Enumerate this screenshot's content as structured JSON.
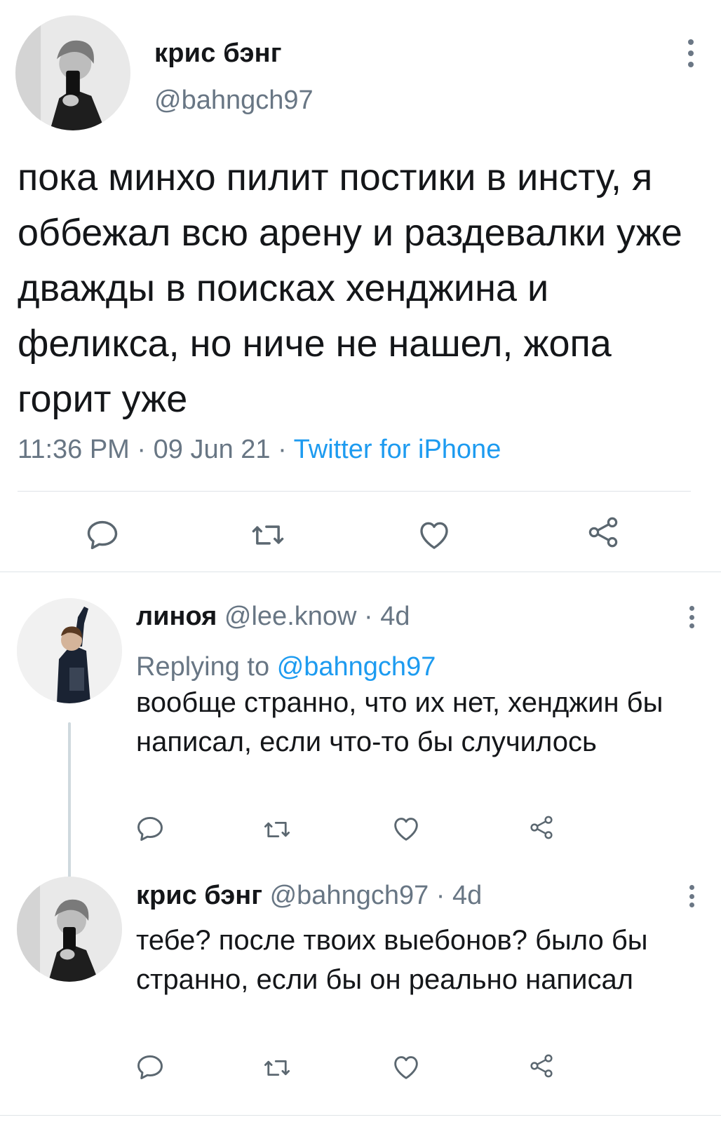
{
  "main_tweet": {
    "author_name": "крис бэнг",
    "author_handle": "@bahngch97",
    "text": "пока минхо пилит постики в инсту, я оббежал всю арену и раздевалки уже дважды в поисках хенджина и феликса, но ниче не нашел, жопа горит уже",
    "time": "11:36 PM",
    "date": "09 Jun 21",
    "source": "Twitter for iPhone",
    "separator": " · "
  },
  "replies": [
    {
      "author_name": "линоя",
      "author_handle": "@lee.know",
      "age": "4d",
      "replying_label": "Replying to",
      "replying_mention": "@bahngch97",
      "text": "вообще странно, что их нет, хенджин бы написал, если что-то бы случилось"
    },
    {
      "author_name": "крис бэнг",
      "author_handle": "@bahngch97",
      "age": "4d",
      "text": "тебе? после твоих выебонов? было бы странно, если бы он реально написал"
    }
  ],
  "icons": [
    "more-icon",
    "reply-icon",
    "retweet-icon",
    "like-icon",
    "share-icon"
  ],
  "colors": {
    "text": "#141619",
    "secondary": "#687684",
    "link": "#1d9bf0",
    "divider": "#dfe3e7",
    "thread_line": "#cfd9de"
  }
}
